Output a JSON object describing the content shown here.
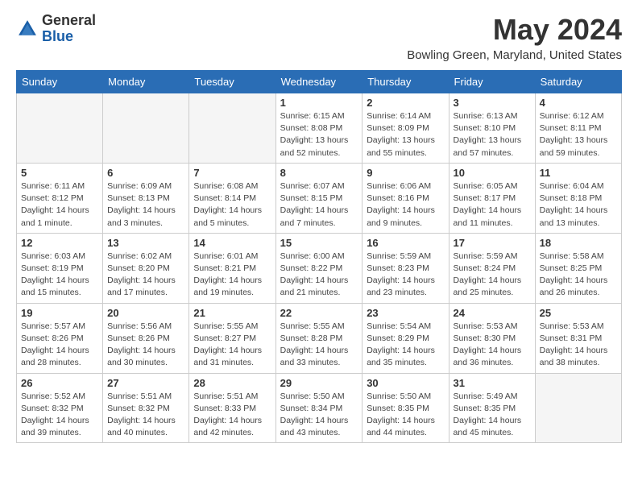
{
  "header": {
    "logo_general": "General",
    "logo_blue": "Blue",
    "month_title": "May 2024",
    "location": "Bowling Green, Maryland, United States"
  },
  "days_of_week": [
    "Sunday",
    "Monday",
    "Tuesday",
    "Wednesday",
    "Thursday",
    "Friday",
    "Saturday"
  ],
  "weeks": [
    [
      {
        "day": "",
        "info": ""
      },
      {
        "day": "",
        "info": ""
      },
      {
        "day": "",
        "info": ""
      },
      {
        "day": "1",
        "info": "Sunrise: 6:15 AM\nSunset: 8:08 PM\nDaylight: 13 hours\nand 52 minutes."
      },
      {
        "day": "2",
        "info": "Sunrise: 6:14 AM\nSunset: 8:09 PM\nDaylight: 13 hours\nand 55 minutes."
      },
      {
        "day": "3",
        "info": "Sunrise: 6:13 AM\nSunset: 8:10 PM\nDaylight: 13 hours\nand 57 minutes."
      },
      {
        "day": "4",
        "info": "Sunrise: 6:12 AM\nSunset: 8:11 PM\nDaylight: 13 hours\nand 59 minutes."
      }
    ],
    [
      {
        "day": "5",
        "info": "Sunrise: 6:11 AM\nSunset: 8:12 PM\nDaylight: 14 hours\nand 1 minute."
      },
      {
        "day": "6",
        "info": "Sunrise: 6:09 AM\nSunset: 8:13 PM\nDaylight: 14 hours\nand 3 minutes."
      },
      {
        "day": "7",
        "info": "Sunrise: 6:08 AM\nSunset: 8:14 PM\nDaylight: 14 hours\nand 5 minutes."
      },
      {
        "day": "8",
        "info": "Sunrise: 6:07 AM\nSunset: 8:15 PM\nDaylight: 14 hours\nand 7 minutes."
      },
      {
        "day": "9",
        "info": "Sunrise: 6:06 AM\nSunset: 8:16 PM\nDaylight: 14 hours\nand 9 minutes."
      },
      {
        "day": "10",
        "info": "Sunrise: 6:05 AM\nSunset: 8:17 PM\nDaylight: 14 hours\nand 11 minutes."
      },
      {
        "day": "11",
        "info": "Sunrise: 6:04 AM\nSunset: 8:18 PM\nDaylight: 14 hours\nand 13 minutes."
      }
    ],
    [
      {
        "day": "12",
        "info": "Sunrise: 6:03 AM\nSunset: 8:19 PM\nDaylight: 14 hours\nand 15 minutes."
      },
      {
        "day": "13",
        "info": "Sunrise: 6:02 AM\nSunset: 8:20 PM\nDaylight: 14 hours\nand 17 minutes."
      },
      {
        "day": "14",
        "info": "Sunrise: 6:01 AM\nSunset: 8:21 PM\nDaylight: 14 hours\nand 19 minutes."
      },
      {
        "day": "15",
        "info": "Sunrise: 6:00 AM\nSunset: 8:22 PM\nDaylight: 14 hours\nand 21 minutes."
      },
      {
        "day": "16",
        "info": "Sunrise: 5:59 AM\nSunset: 8:23 PM\nDaylight: 14 hours\nand 23 minutes."
      },
      {
        "day": "17",
        "info": "Sunrise: 5:59 AM\nSunset: 8:24 PM\nDaylight: 14 hours\nand 25 minutes."
      },
      {
        "day": "18",
        "info": "Sunrise: 5:58 AM\nSunset: 8:25 PM\nDaylight: 14 hours\nand 26 minutes."
      }
    ],
    [
      {
        "day": "19",
        "info": "Sunrise: 5:57 AM\nSunset: 8:26 PM\nDaylight: 14 hours\nand 28 minutes."
      },
      {
        "day": "20",
        "info": "Sunrise: 5:56 AM\nSunset: 8:26 PM\nDaylight: 14 hours\nand 30 minutes."
      },
      {
        "day": "21",
        "info": "Sunrise: 5:55 AM\nSunset: 8:27 PM\nDaylight: 14 hours\nand 31 minutes."
      },
      {
        "day": "22",
        "info": "Sunrise: 5:55 AM\nSunset: 8:28 PM\nDaylight: 14 hours\nand 33 minutes."
      },
      {
        "day": "23",
        "info": "Sunrise: 5:54 AM\nSunset: 8:29 PM\nDaylight: 14 hours\nand 35 minutes."
      },
      {
        "day": "24",
        "info": "Sunrise: 5:53 AM\nSunset: 8:30 PM\nDaylight: 14 hours\nand 36 minutes."
      },
      {
        "day": "25",
        "info": "Sunrise: 5:53 AM\nSunset: 8:31 PM\nDaylight: 14 hours\nand 38 minutes."
      }
    ],
    [
      {
        "day": "26",
        "info": "Sunrise: 5:52 AM\nSunset: 8:32 PM\nDaylight: 14 hours\nand 39 minutes."
      },
      {
        "day": "27",
        "info": "Sunrise: 5:51 AM\nSunset: 8:32 PM\nDaylight: 14 hours\nand 40 minutes."
      },
      {
        "day": "28",
        "info": "Sunrise: 5:51 AM\nSunset: 8:33 PM\nDaylight: 14 hours\nand 42 minutes."
      },
      {
        "day": "29",
        "info": "Sunrise: 5:50 AM\nSunset: 8:34 PM\nDaylight: 14 hours\nand 43 minutes."
      },
      {
        "day": "30",
        "info": "Sunrise: 5:50 AM\nSunset: 8:35 PM\nDaylight: 14 hours\nand 44 minutes."
      },
      {
        "day": "31",
        "info": "Sunrise: 5:49 AM\nSunset: 8:35 PM\nDaylight: 14 hours\nand 45 minutes."
      },
      {
        "day": "",
        "info": ""
      }
    ]
  ]
}
